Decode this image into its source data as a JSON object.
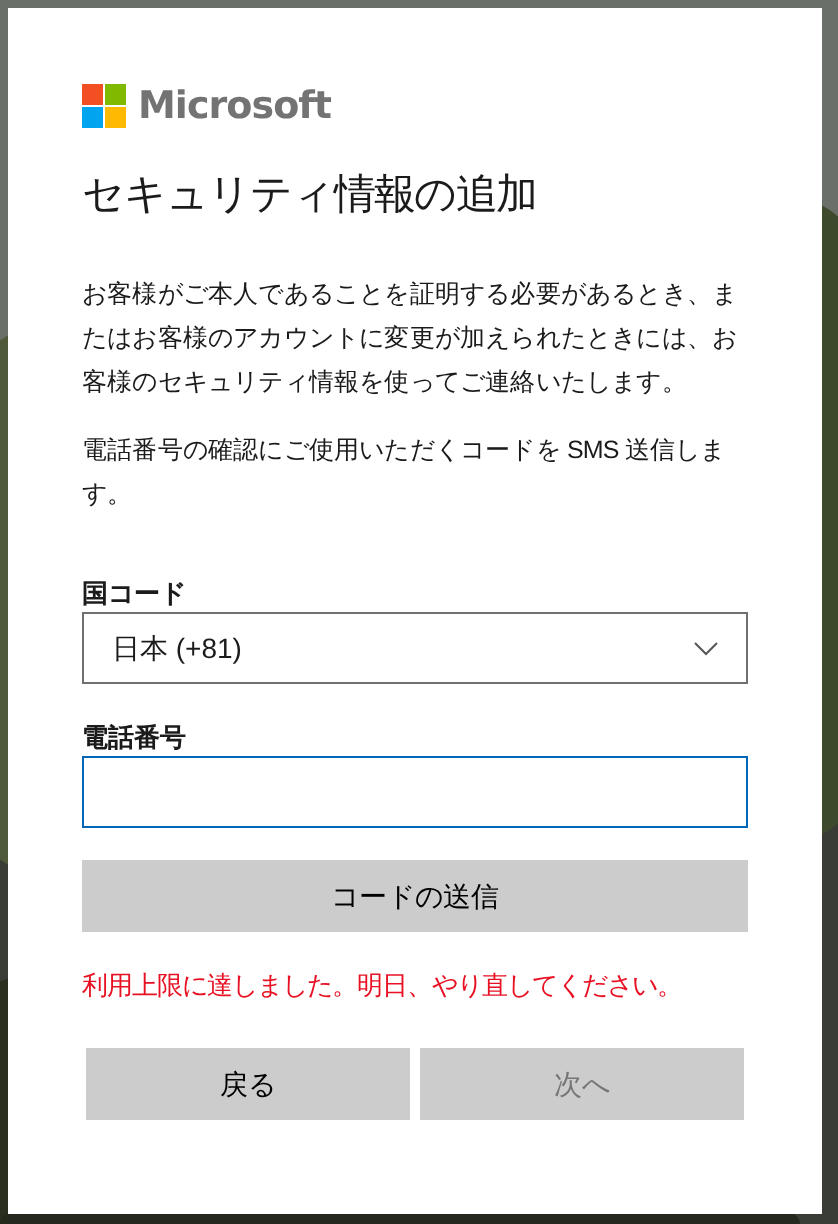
{
  "brand": {
    "name": "Microsoft"
  },
  "title": "セキュリティ情報の追加",
  "paragraphs": [
    "お客様がご本人であることを証明する必要があるとき、またはお客様のアカウントに変更が加えられたときには、お客様のセキュリティ情報を使ってご連絡いたします。",
    "電話番号の確認にご使用いただくコードを SMS 送信します。"
  ],
  "country": {
    "label": "国コード",
    "value": "日本 (+81)"
  },
  "phone": {
    "label": "電話番号"
  },
  "send_button": {
    "label": "コードの送信",
    "disabled": false
  },
  "error": "利用上限に達しました。明日、やり直してください。",
  "buttons": [
    {
      "label": "戻る",
      "disabled": false
    },
    {
      "label": "次へ",
      "disabled": true
    }
  ]
}
